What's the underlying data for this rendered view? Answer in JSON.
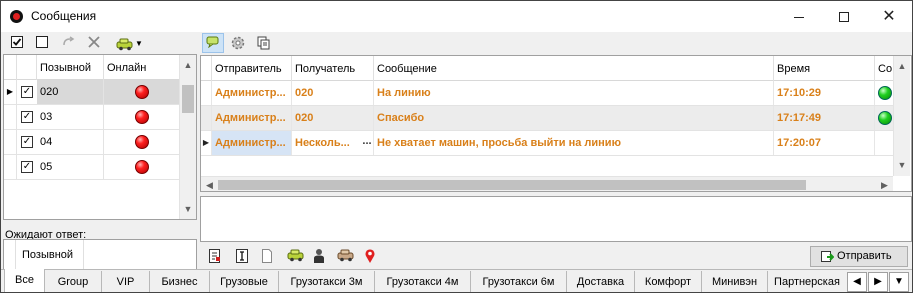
{
  "window": {
    "title": "Сообщения",
    "minimize_icon": "minimize-icon",
    "maximize_icon": "maximize-icon",
    "close_symbol": "✕"
  },
  "left_grid": {
    "columns": [
      "Позывной",
      "Онлайн"
    ],
    "rows": [
      {
        "callsign": "020",
        "checked": true,
        "online": "red",
        "selected": true
      },
      {
        "callsign": "03",
        "checked": true,
        "online": "red",
        "selected": false
      },
      {
        "callsign": "04",
        "checked": true,
        "online": "red",
        "selected": false
      },
      {
        "callsign": "05",
        "checked": true,
        "online": "red",
        "selected": false
      }
    ]
  },
  "waiting": {
    "label": "Ожидают ответ:",
    "column": "Позывной"
  },
  "messages": {
    "columns": [
      "Отправитель",
      "Получатель",
      "Сообщение",
      "Время",
      "Со"
    ],
    "rows": [
      {
        "sender": "Администр...",
        "recipient": "020",
        "message": "На линию",
        "time": "17:10:29",
        "status": "green"
      },
      {
        "sender": "Администр...",
        "recipient": "020",
        "message": "Спасибо",
        "time": "17:17:49",
        "status": "green"
      },
      {
        "sender": "Администр...",
        "recipient": "Несколь...",
        "message": "Не хватает машин, просьба выйти на линию",
        "time": "17:20:07",
        "status": ""
      }
    ],
    "ellipsis": "..."
  },
  "send_button": "Отправить",
  "tabs": [
    "Все",
    "Group",
    "VIP",
    "Бизнес",
    "Грузовые",
    "Грузотакси 3м",
    "Грузотакси 4м",
    "Грузотакси 6м",
    "Доставка",
    "Комфорт",
    "Минивэн",
    "Партнерская"
  ],
  "colors": {
    "message_text": "#d9801a",
    "selected_row": "#d9d9d9",
    "status_online": "#20d020",
    "status_offline": "#ff2020"
  }
}
